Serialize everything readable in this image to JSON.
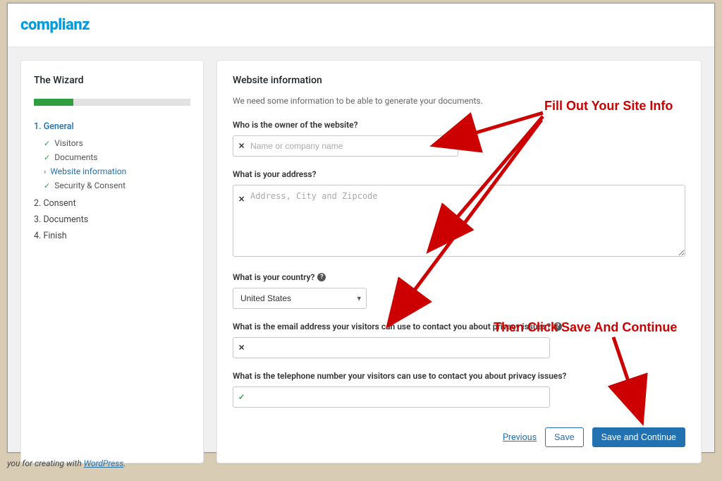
{
  "brand": "complianz",
  "sidebar": {
    "title": "The Wizard",
    "progress_percent": 25,
    "steps": [
      {
        "num": "1.",
        "label": "General",
        "active": true,
        "sub": [
          {
            "label": "Visitors",
            "state": "done"
          },
          {
            "label": "Documents",
            "state": "done"
          },
          {
            "label": "Website information",
            "state": "current"
          },
          {
            "label": "Security & Consent",
            "state": "done"
          }
        ]
      },
      {
        "num": "2.",
        "label": "Consent"
      },
      {
        "num": "3.",
        "label": "Documents"
      },
      {
        "num": "4.",
        "label": "Finish"
      }
    ]
  },
  "main": {
    "title": "Website information",
    "intro": "We need some information to be able to generate your documents.",
    "fields": {
      "owner": {
        "label": "Who is the owner of the website?",
        "placeholder": "Name or company name",
        "value": "",
        "status": "error"
      },
      "address": {
        "label": "What is your address?",
        "placeholder": "Address, City and Zipcode",
        "value": "",
        "status": "error"
      },
      "country": {
        "label": "What is your country?",
        "value": "United States"
      },
      "email": {
        "label": "What is the email address your visitors can use to contact you about privacy issues?",
        "value": "",
        "status": "error"
      },
      "phone": {
        "label": "What is the telephone number your visitors can use to contact you about privacy issues?",
        "value": "",
        "status": "ok"
      }
    },
    "buttons": {
      "previous": "Previous",
      "save": "Save",
      "save_continue": "Save and Continue"
    }
  },
  "credit": {
    "prefix": "you for creating with ",
    "link": "WordPress",
    "suffix": "."
  },
  "annotations": {
    "fill": "Fill Out Your Site Info",
    "save": "Then Click Save And Continue"
  }
}
